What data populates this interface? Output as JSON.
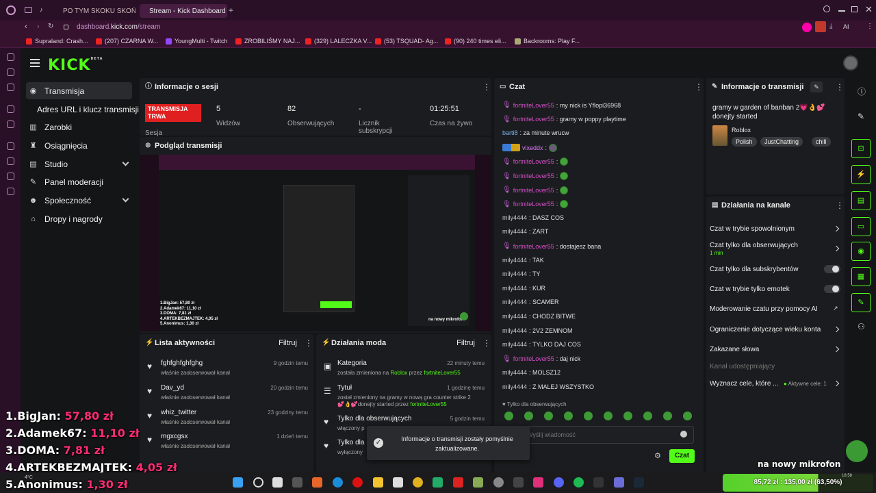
{
  "browser": {
    "tabs": [
      {
        "label": "PO TYM SKOKU SKOŃCZ"
      },
      {
        "label": "Stream - Kick Dashboard",
        "active": true
      }
    ],
    "url_prefix": "dashboard.",
    "url_domain": "kick.com",
    "url_path": "/stream",
    "bookmarks": [
      {
        "label": "Supraland: Crash..."
      },
      {
        "label": "(207) CZARNA W..."
      },
      {
        "label": "YoungMulti - Twitch"
      },
      {
        "label": "ZROBILIŚMY NAJ..."
      },
      {
        "label": "(329) LALECZKA V..."
      },
      {
        "label": "(53) TSQUAD- Ag..."
      },
      {
        "label": "(90) 240 times eli..."
      },
      {
        "label": "Backrooms: Play F..."
      }
    ],
    "ai_label": "AI"
  },
  "brand": {
    "logo": "KICK",
    "beta": "BETA",
    "accent": "#53fc18"
  },
  "sidebar": {
    "items": [
      {
        "label": "Transmisja",
        "icon": "broadcast-icon"
      },
      {
        "label": "Adres URL i klucz transmisji"
      },
      {
        "label": "Zarobki",
        "icon": "chart-icon"
      },
      {
        "label": "Osiągnięcia",
        "icon": "trophy-icon"
      },
      {
        "label": "Studio",
        "icon": "studio-icon"
      },
      {
        "label": "Panel moderacji",
        "icon": "wrench-icon"
      },
      {
        "label": "Społeczność",
        "icon": "people-icon"
      },
      {
        "label": "Dropy i nagrody",
        "icon": "gift-icon"
      }
    ]
  },
  "session": {
    "title": "Informacje o sesji",
    "live_badge": "TRANSMISJA TRWA",
    "session_label": "Sesja",
    "viewers_value": "5",
    "viewers_label": "Widzów",
    "followers_value": "82",
    "followers_label": "Obserwujących",
    "subs_value": "-",
    "subs_label": "Licznik subskrypcji",
    "uptime_value": "01:25:51",
    "uptime_label": "Czas na żywo"
  },
  "preview": {
    "title": "Podgląd transmisji",
    "overlay_lines": [
      "1.BigJan: 57,80 zł",
      "2.Adamek67: 11,10 zł",
      "3.DOMA: 7,81 zł",
      "4.ARTEKBEZMAJTEK: 4,05 zł",
      "5.Anonimus: 1,30 zł"
    ],
    "mic_text": "na nowy mikrofon"
  },
  "activity": {
    "title": "Lista aktywności",
    "filter": "Filtruj",
    "rows": [
      {
        "name": "fghfghfghfghg",
        "sub": "właśnie zaobserwował kanał",
        "time": "9 godzin temu"
      },
      {
        "name": "Dav_yd",
        "sub": "właśnie zaobserwował kanał",
        "time": "20 godzin temu"
      },
      {
        "name": "whiz_twitter",
        "sub": "właśnie zaobserwował kanał",
        "time": "23 godziny temu"
      },
      {
        "name": "mgxcgsx",
        "sub": "właśnie zaobserwował kanał",
        "time": "1 dzień temu"
      }
    ]
  },
  "modactions": {
    "title": "Działania moda",
    "filter": "Filtruj",
    "rows": [
      {
        "name": "Kategoria",
        "time": "22 minuty temu",
        "sub1": "została zmieniona na ",
        "hl1": "Roblox",
        "sub2": " przez ",
        "hl2": "fortniteLover55"
      },
      {
        "name": "Tytuł",
        "time": "1 godzinę temu",
        "sub1": "został zmieniony na gramy w nową gra counter strike 2",
        "line2": "💕👌💕donejty started przez ",
        "hl2": "fortniteLover55"
      },
      {
        "name": "Tylko dla obserwujących",
        "time": "5 godzin temu",
        "sub1": "włączony p"
      },
      {
        "name": "Tylko dla",
        "time": "",
        "sub1": "wyłączony"
      }
    ]
  },
  "chat": {
    "title": "Czat",
    "messages": [
      {
        "user": "fortniteLover55",
        "mic": true,
        "cls": "u-pink",
        "text": ": my nick is Yflopi36968"
      },
      {
        "user": "fortniteLover55",
        "mic": true,
        "cls": "u-pink",
        "text": ": gramy w poppy playtime"
      },
      {
        "user": "barti8",
        "cls": "u-blue",
        "text": ": za minute wrucw"
      },
      {
        "user": "vixeddx",
        "cls": "u-orange",
        "text": ":",
        "emote": true,
        "badges": true
      },
      {
        "user": "fortniteLover55",
        "mic": true,
        "cls": "u-pink",
        "text": ":",
        "emote": true
      },
      {
        "user": "fortniteLover55",
        "mic": true,
        "cls": "u-pink",
        "text": ":",
        "emote": true
      },
      {
        "user": "fortniteLover55",
        "mic": true,
        "cls": "u-pink",
        "text": ":",
        "emote": true
      },
      {
        "user": "fortniteLover55",
        "mic": true,
        "cls": "u-pink",
        "text": ":",
        "emote": true
      },
      {
        "user": "mily4444",
        "cls": "u-gray",
        "text": ": DASZ COS"
      },
      {
        "user": "mily4444",
        "cls": "u-gray",
        "text": ": ZART"
      },
      {
        "user": "fortniteLover55",
        "mic": true,
        "cls": "u-pink",
        "text": ": dostajesz bana"
      },
      {
        "user": "mily4444",
        "cls": "u-gray",
        "text": ": TAK"
      },
      {
        "user": "mily4444",
        "cls": "u-gray",
        "text": ": TY"
      },
      {
        "user": "mily4444",
        "cls": "u-gray",
        "text": ": KUR"
      },
      {
        "user": "mily4444",
        "cls": "u-gray",
        "text": ": SCAMER"
      },
      {
        "user": "mily4444",
        "cls": "u-gray",
        "text": ": CHODZ BITWE"
      },
      {
        "user": "mily4444",
        "cls": "u-gray",
        "text": ": 2V2 ZEMNOM"
      },
      {
        "user": "mily4444",
        "cls": "u-gray",
        "text": ": TYLKO DAJ COS"
      },
      {
        "user": "fortniteLover55",
        "mic": true,
        "cls": "u-pink",
        "text": ": daj nick"
      },
      {
        "user": "mily4444",
        "cls": "u-gray",
        "text": ": MOLSZ12"
      },
      {
        "user": "mily4444",
        "cls": "u-gray",
        "text": ": Z MALEJ WSZYSTKO"
      }
    ],
    "followers_only": "Tylko dla obserwujących",
    "placeholder": "Wyślij wiadomość",
    "send": "Czat"
  },
  "stream_info": {
    "title": "Informacje o transmisji",
    "stream_title": "gramy w garden of banban 2💗👌💕 donejty started",
    "category": "Roblox",
    "tags": [
      "Polish",
      "JustChatting",
      "chill"
    ]
  },
  "channel_actions": {
    "title": "Działania na kanale",
    "rows": [
      {
        "label": "Czat w trybie spowolnionym",
        "type": "chev"
      },
      {
        "label": "Czat tylko dla obserwujących",
        "sub": "1 min",
        "type": "chev"
      },
      {
        "label": "Czat tylko dla subskrybentów",
        "type": "toggle"
      },
      {
        "label": "Czat w trybie tylko emotek",
        "type": "toggle"
      },
      {
        "label": "Moderowanie czatu przy pomocy AI",
        "type": "link"
      },
      {
        "label": "Ograniczenie dotyczące wieku konta",
        "type": "chev"
      },
      {
        "label": "Zakazane słowa",
        "type": "chev"
      },
      {
        "label": "Kanał udostępniający",
        "type": "disabled"
      },
      {
        "label": "Wyznacz cele, które ...",
        "extra": "Aktywne cele: 1",
        "type": "chev"
      }
    ]
  },
  "toast": {
    "text": "Informacje o transmisji zostały pomyślnie zaktualizowane."
  },
  "overlay": {
    "donations": [
      {
        "rank": "1.",
        "name": "BigJan:",
        "amount": "57,80 zł"
      },
      {
        "rank": "2.",
        "name": "Adamek67:",
        "amount": "11,10 zł"
      },
      {
        "rank": "3.",
        "name": "DOMA:",
        "amount": "7,81 zł"
      },
      {
        "rank": "4.",
        "name": "ARTEKBEZMAJTEK:",
        "amount": "4,05 zł"
      },
      {
        "rank": "5.",
        "name": "Anonimus:",
        "amount": "1,30 zł"
      }
    ],
    "mic_caption": "na nowy mikrofon",
    "goal": "85,72 zł : 135,00 zł (63,50%)",
    "goal_fraction": 0.635,
    "weather": "4°C"
  },
  "taskbar": {
    "clock_time": "18:58"
  }
}
